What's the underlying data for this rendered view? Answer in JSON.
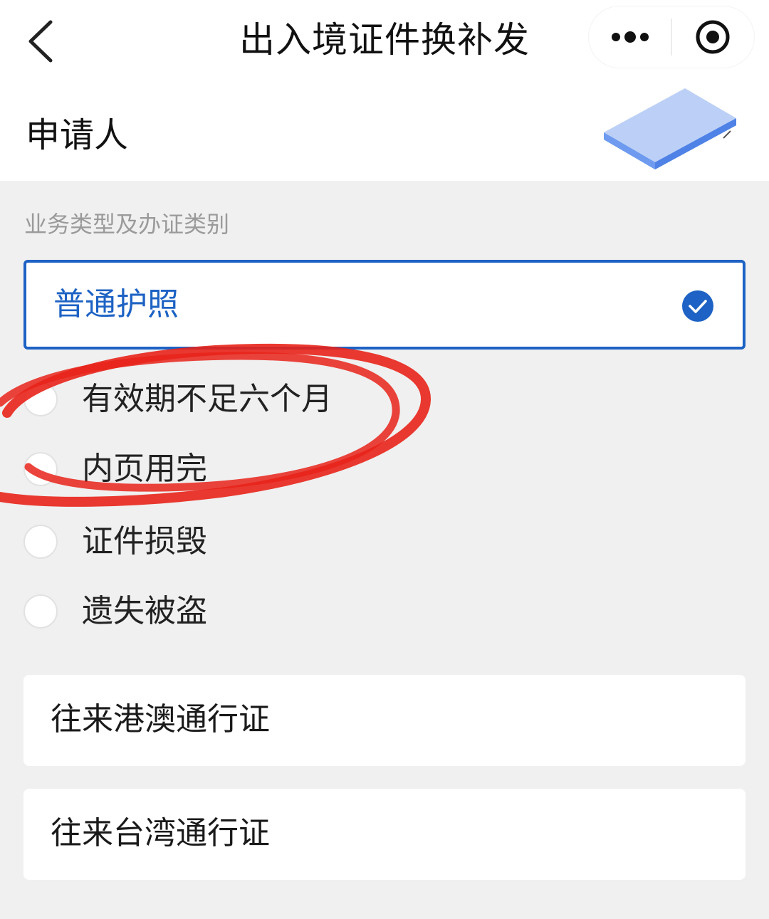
{
  "navbar": {
    "title": "出入境证件换补发",
    "back_icon": "chevron-left-icon",
    "more_icon": "more-dots-icon",
    "close_icon": "target-close-icon"
  },
  "applicant": {
    "label": "申请人",
    "illustration": "id-card-illustration"
  },
  "section": {
    "label": "业务类型及办证类别"
  },
  "passport": {
    "label": "普通护照",
    "selected": true,
    "reasons": [
      {
        "label": "有效期不足六个月",
        "checked": false
      },
      {
        "label": "内页用完",
        "checked": false
      },
      {
        "label": "证件损毁",
        "checked": false
      },
      {
        "label": "遗失被盗",
        "checked": false
      }
    ]
  },
  "other_documents": [
    {
      "label": "往来港澳通行证"
    },
    {
      "label": "往来台湾通行证"
    }
  ],
  "colors": {
    "accent": "#1d62c4",
    "annotation": "#e8231a",
    "background": "#f0f0f0"
  }
}
